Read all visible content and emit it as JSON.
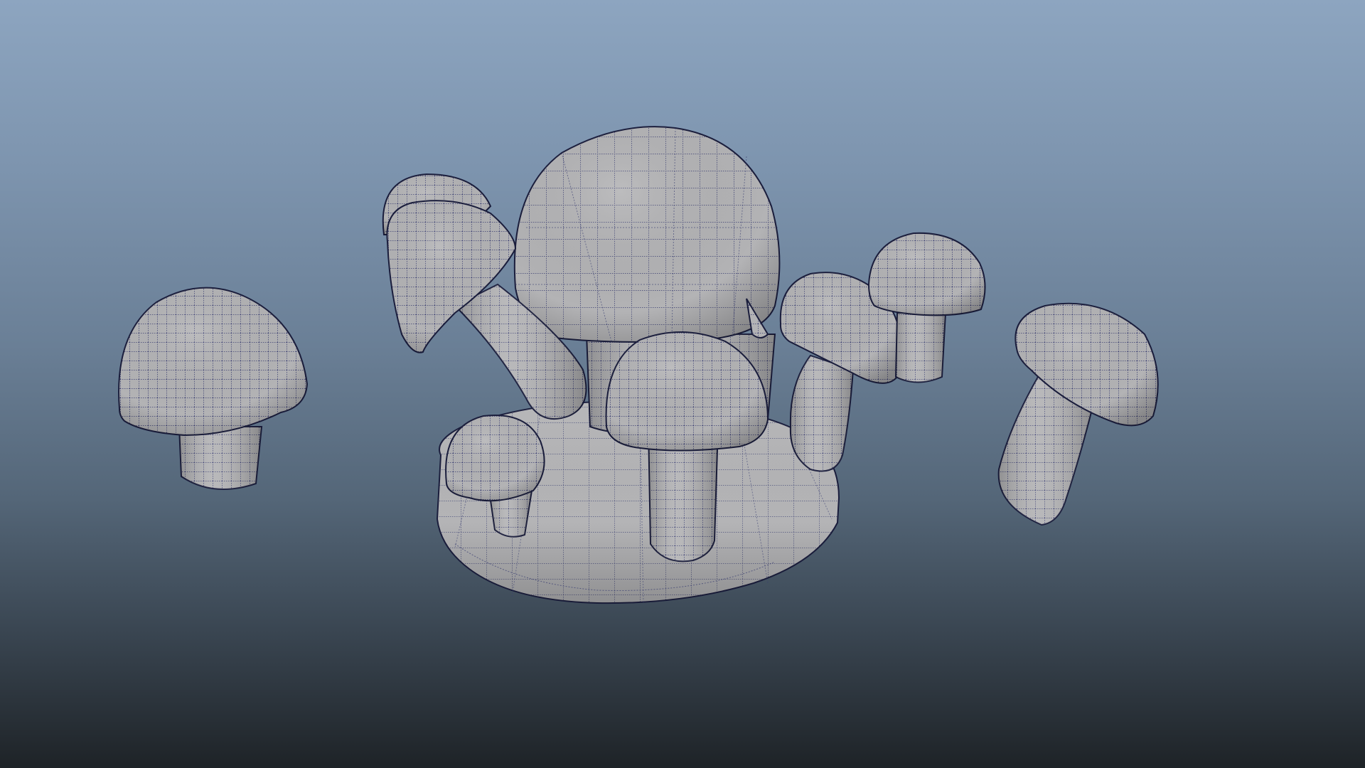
{
  "viewport": {
    "background_top": "#8da5c0",
    "background_bottom": "#1e2327",
    "shader": "wireframe-on-shaded",
    "mesh_fill": "#b3b3b5",
    "wire_color": "#3a3f72",
    "outline_color": "#1a1d3c"
  },
  "scene": {
    "object_type": "polygon-mesh",
    "objects": [
      "ground-mound",
      "large-mushroom",
      "back-left-mushroom",
      "tilted-left-mushroom",
      "small-front-mushroom",
      "front-center-mushroom",
      "right-curved-mushroom",
      "back-right-mushroom",
      "far-left-mushroom",
      "far-right-mushroom"
    ]
  }
}
